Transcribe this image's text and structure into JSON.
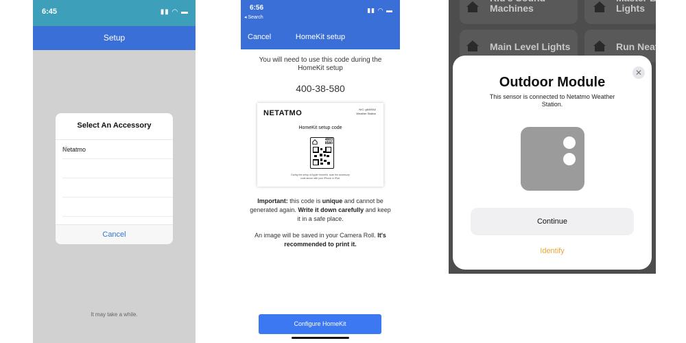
{
  "phone1": {
    "status_time": "6:45",
    "nav_title": "Setup",
    "dialog_title": "Select An Accessory",
    "accessories": [
      "Netatmo",
      "",
      "",
      ""
    ],
    "cancel_label": "Cancel",
    "hint": "It may take a while."
  },
  "phone2": {
    "status_time": "6:56",
    "back_label": "◂ Search",
    "nav_cancel": "Cancel",
    "nav_title": "HomeKit setup",
    "intro": "You will need to use this code during the HomeKit setup",
    "setup_code": "400-38-580",
    "card": {
      "brand": "NETATMO",
      "serial": "N/C: g640542 Weather Station",
      "title": "HomeKit setup code",
      "qr_digits_1": "4003",
      "qr_digits_2": "8580",
      "note": "During the setup of Apple HomeKit, scan the accessory code above with your iPhone or iPad."
    },
    "important_label": "Important:",
    "important_text_1": " this code is ",
    "important_unique": "unique",
    "important_text_2": " and cannot be generated again. ",
    "important_write": "Write it down carefully",
    "important_text_3": " and keep it in a safe place.",
    "roll_text": "An image will be saved in your Camera Roll. ",
    "roll_bold": "It's recommended to print it.",
    "configure_label": "Configure HomeKit"
  },
  "phone3": {
    "tiles": [
      {
        "label": "Kid's Sound Machines"
      },
      {
        "label": "Master B Lights"
      },
      {
        "label": "Main Level Lights"
      },
      {
        "label": "Run Neat"
      }
    ],
    "sheet_title": "Outdoor Module",
    "sheet_subtitle": "This sensor is connected to Netatmo Weather Station.",
    "continue_label": "Continue",
    "identify_label": "Identify",
    "colors": {
      "identify": "#f2a431",
      "module": "#9b9b9b"
    }
  }
}
